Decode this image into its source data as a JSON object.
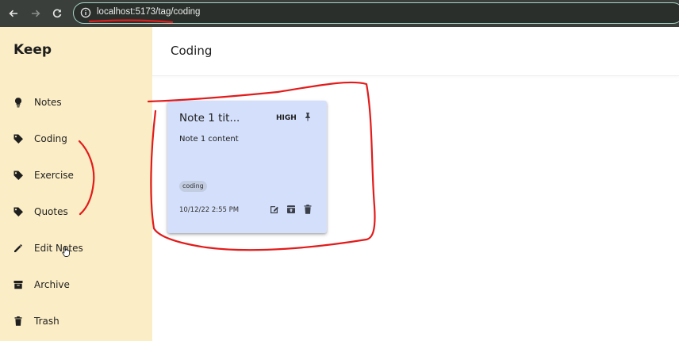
{
  "browser": {
    "url": "localhost:5173/tag/coding",
    "icons": [
      "back-arrow-icon",
      "forward-arrow-icon",
      "reload-icon",
      "info-icon"
    ]
  },
  "sidebar": {
    "app_title": "Keep",
    "items": [
      {
        "label": "Notes",
        "icon": "lightbulb-icon"
      },
      {
        "label": "Coding",
        "icon": "tag-icon"
      },
      {
        "label": "Exercise",
        "icon": "tag-icon"
      },
      {
        "label": "Quotes",
        "icon": "tag-icon"
      },
      {
        "label": "Edit Notes",
        "icon": "pencil-icon"
      },
      {
        "label": "Archive",
        "icon": "archive-icon"
      },
      {
        "label": "Trash",
        "icon": "trash-icon"
      }
    ]
  },
  "header": {
    "title": "Coding"
  },
  "note": {
    "title": "Note 1 tit...",
    "priority": "HIGH",
    "content": "Note 1 content",
    "tag": "coding",
    "timestamp": "10/12/22 2:55 PM",
    "actions": [
      "edit-icon",
      "archive-icon",
      "delete-icon"
    ]
  },
  "colors": {
    "sidebar_bg": "#fbedc5",
    "card_bg": "#d4e0fb",
    "annotation": "#e21b1b"
  }
}
